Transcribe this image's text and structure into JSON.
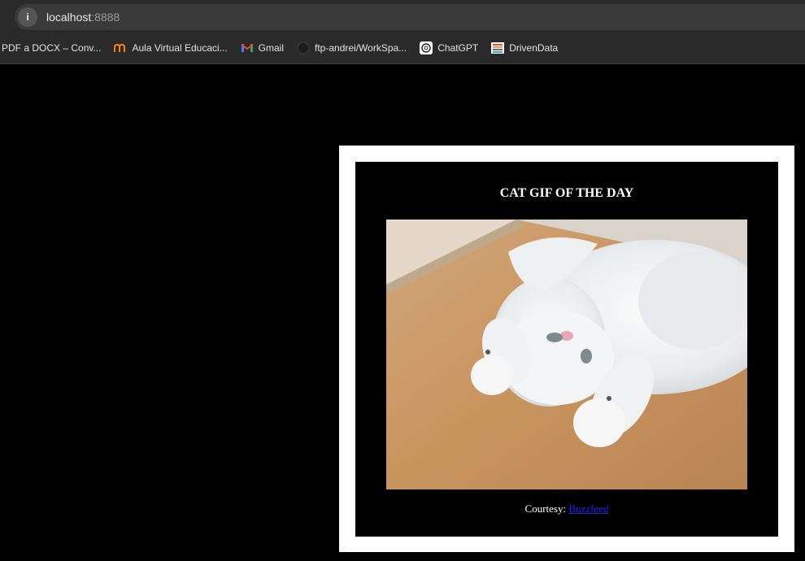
{
  "browser": {
    "url_host": "localhost",
    "url_port": ":8888",
    "bookmarks": [
      {
        "label": "PDF a DOCX – Conv...",
        "icon": "document-icon"
      },
      {
        "label": "Aula Virtual Educaci...",
        "icon": "moodle-icon"
      },
      {
        "label": "Gmail",
        "icon": "gmail-icon"
      },
      {
        "label": "ftp-andrei/WorkSpa...",
        "icon": "github-icon"
      },
      {
        "label": "ChatGPT",
        "icon": "chatgpt-icon"
      },
      {
        "label": "DrivenData",
        "icon": "drivendata-icon"
      }
    ]
  },
  "page": {
    "title": "CAT GIF OF THE DAY",
    "image_subject": "white kitten lying on its back on wooden floor",
    "caption_prefix": "Courtesy: ",
    "caption_link": "Buzzfeed"
  }
}
